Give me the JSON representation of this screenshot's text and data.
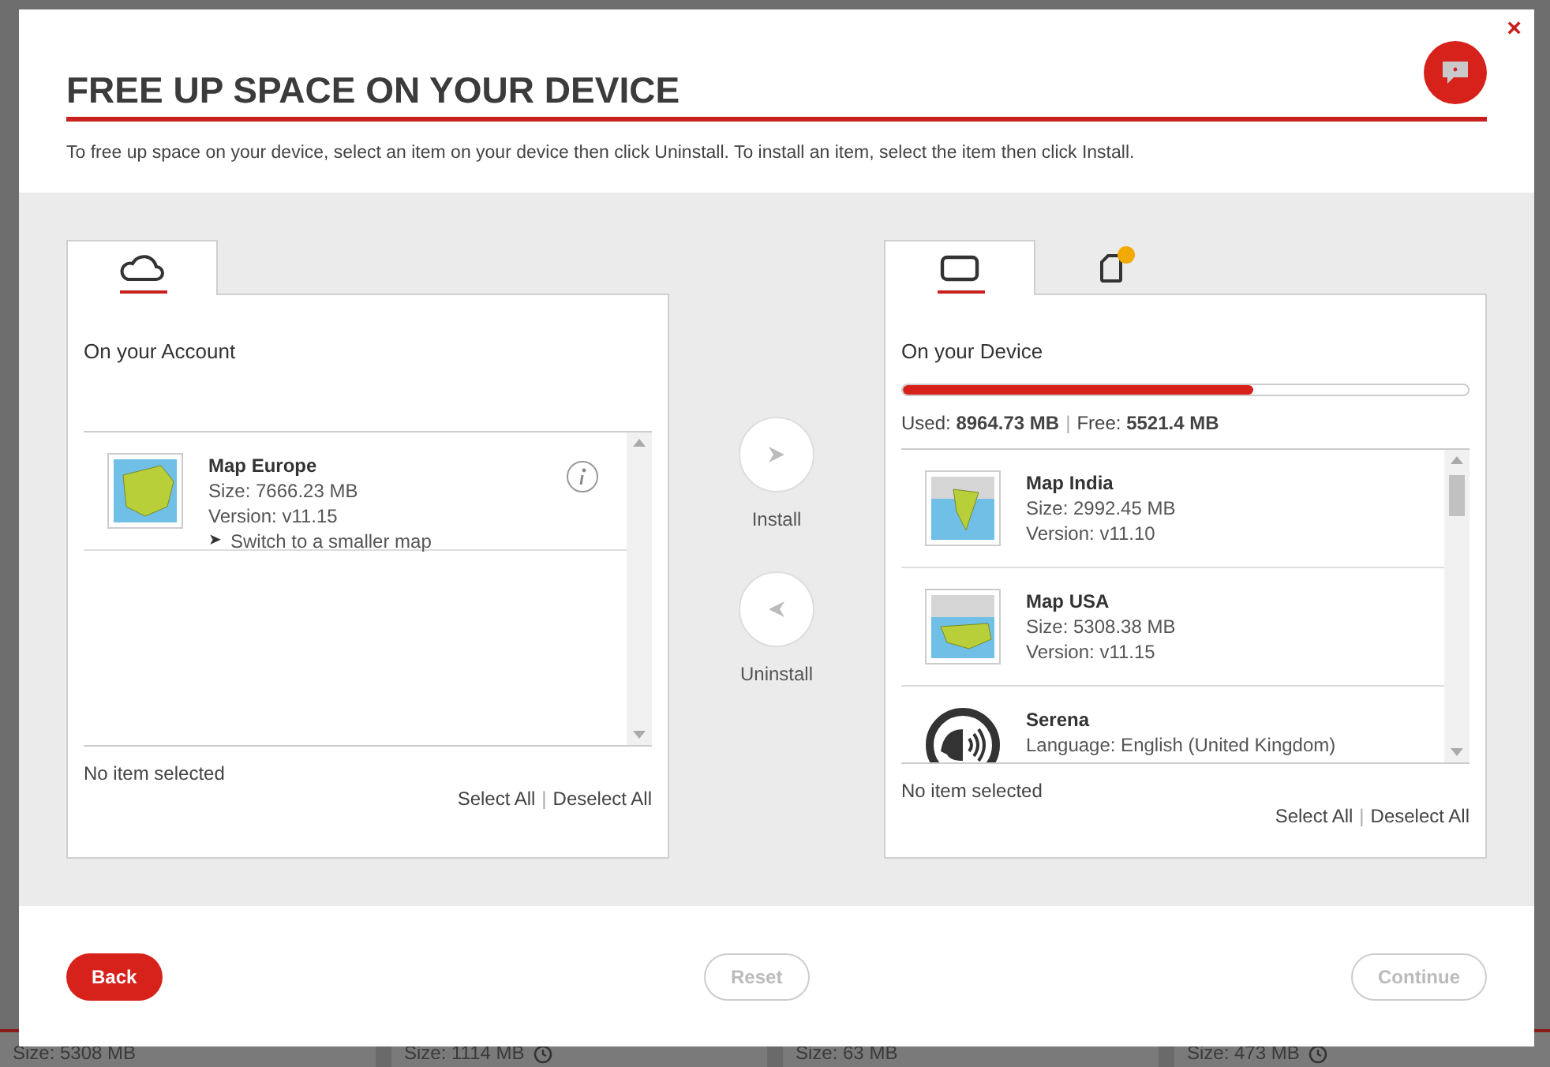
{
  "background_cards": [
    {
      "size": "Size:  5308 MB",
      "clock": false
    },
    {
      "size": "Size:  1114 MB",
      "clock": true
    },
    {
      "size": "Size:  63 MB",
      "clock": false
    },
    {
      "size": "Size:  473 MB",
      "clock": true
    }
  ],
  "dialog": {
    "title": "FREE UP SPACE ON YOUR DEVICE",
    "close": "×",
    "help": true,
    "intro": "To free up space on your device, select an item on your device then click Uninstall. To install an item, select the item then click Install."
  },
  "account_panel": {
    "tabs": [
      {
        "kind": "cloud",
        "selected": true,
        "warning": false
      }
    ],
    "heading": "On your Account",
    "items": [
      {
        "kind": "europe",
        "name": "Map Europe",
        "lines": [
          "Size: 7666.23 MB",
          "Version: v11.15"
        ],
        "link_arrow": "➤",
        "link": "Switch to a smaller map",
        "info": true
      }
    ],
    "status": "No item selected",
    "select_all": "Select All",
    "separator": "|",
    "deselect_all": "Deselect All"
  },
  "transfer": [
    {
      "kind": "install",
      "label": "Install"
    },
    {
      "kind": "uninstall",
      "label": "Uninstall"
    }
  ],
  "device_panel": {
    "tabs": [
      {
        "kind": "device",
        "selected": true,
        "warning": false
      },
      {
        "kind": "card",
        "selected": false,
        "warning": true
      }
    ],
    "heading": "On your Device",
    "storage": {
      "level": 0.619,
      "used_label": "Used:",
      "used": "8964.73 MB",
      "separator": "|",
      "free_label": "Free:",
      "free": "5521.4 MB"
    },
    "items": [
      {
        "kind": "india",
        "name": "Map India",
        "lines": [
          "Size: 2992.45 MB",
          "Version: v11.10"
        ],
        "info": false
      },
      {
        "kind": "usa",
        "name": "Map USA",
        "lines": [
          "Size: 5308.38 MB",
          "Version: v11.15"
        ],
        "info": false
      },
      {
        "kind": "voice",
        "name": "Serena",
        "lines": [
          "Language: English (United Kingdom)"
        ],
        "info": false
      }
    ],
    "status": "No item selected",
    "select_all": "Select All",
    "separator": "|",
    "deselect_all": "Deselect All"
  },
  "footer": [
    {
      "label": "Back",
      "kind": "primary",
      "disabled": false
    },
    {
      "label": "Reset",
      "kind": "outline",
      "disabled": true
    },
    {
      "label": "Continue",
      "kind": "outline",
      "disabled": true
    }
  ]
}
